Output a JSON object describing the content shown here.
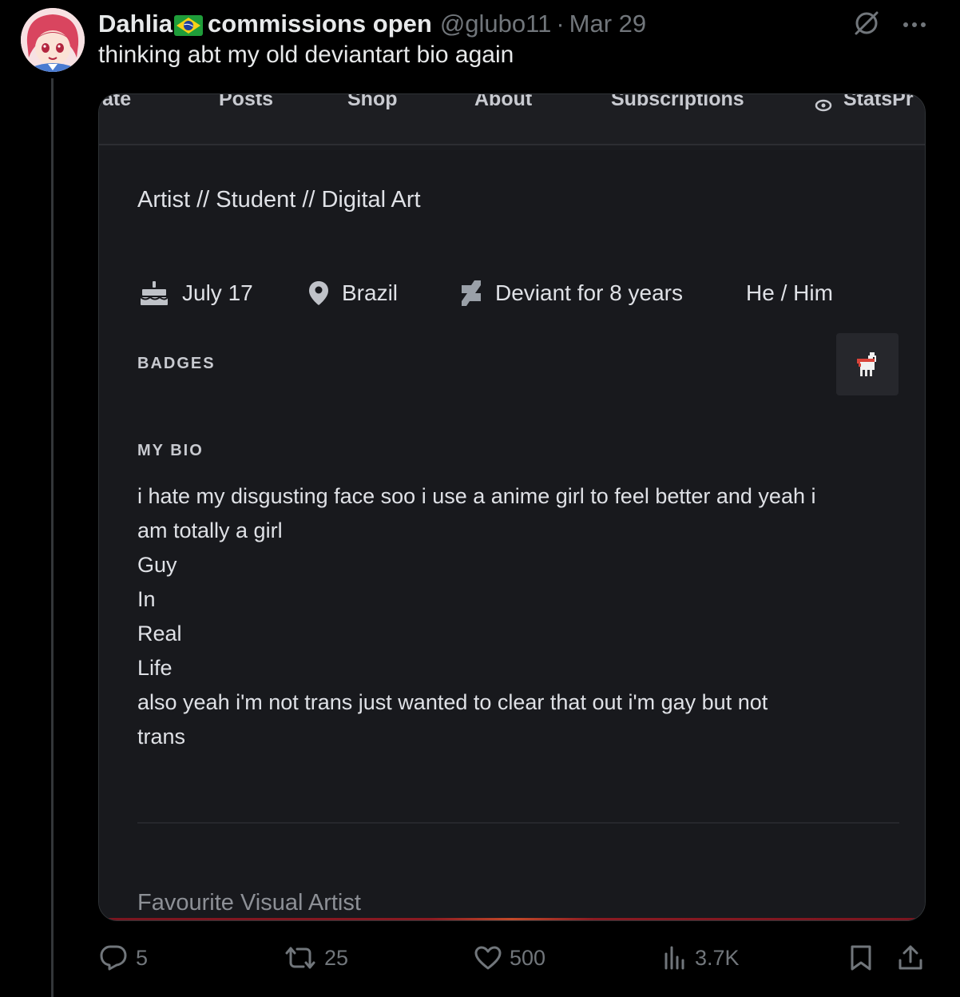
{
  "tweet": {
    "display_name": "Dahlia",
    "display_name_suffix": "commissions open",
    "handle": "@glubo11",
    "separator": "·",
    "date": "Mar 29",
    "text": "thinking abt my old deviantart bio again"
  },
  "screenshot": {
    "nav": {
      "items": [
        "ate",
        "Posts",
        "Shop",
        "About",
        "Subscriptions",
        "Stats"
      ],
      "pro_fragment": "Pr"
    },
    "tagline": "Artist  //  Student  //  Digital Art",
    "meta": {
      "birthday": "July 17",
      "location": "Brazil",
      "member_since": "Deviant for 8 years",
      "pronouns": "He / Him"
    },
    "badges_label": "BADGES",
    "bio_label": "MY BIO",
    "bio_lines": [
      "i hate my disgusting face soo i use a anime girl to feel better and yeah i",
      "am totally a girl",
      "Guy",
      "In",
      "Real",
      "Life",
      "also yeah i'm not trans just wanted to clear that out i'm gay but not",
      "trans"
    ],
    "favourite_label": "Favourite Visual Artist"
  },
  "actions": {
    "replies": "5",
    "reposts": "25",
    "likes": "500",
    "views": "3.7K"
  },
  "colors": {
    "background": "#000000",
    "text_primary": "#e7e9ea",
    "text_secondary": "#71767b",
    "da_panel": "#18191d",
    "da_accent": "#6d75ff"
  },
  "icons": {
    "flag": "brazil-flag-icon",
    "grok": "grok-icon",
    "more": "more-dots-icon",
    "birthday": "cake-icon",
    "location": "map-pin-icon",
    "deviant": "deviantart-logo-icon",
    "badge": "llama-badge-icon",
    "reply": "reply-icon",
    "repost": "repost-icon",
    "like": "heart-icon",
    "views": "views-icon",
    "bookmark": "bookmark-icon",
    "share": "share-icon"
  }
}
